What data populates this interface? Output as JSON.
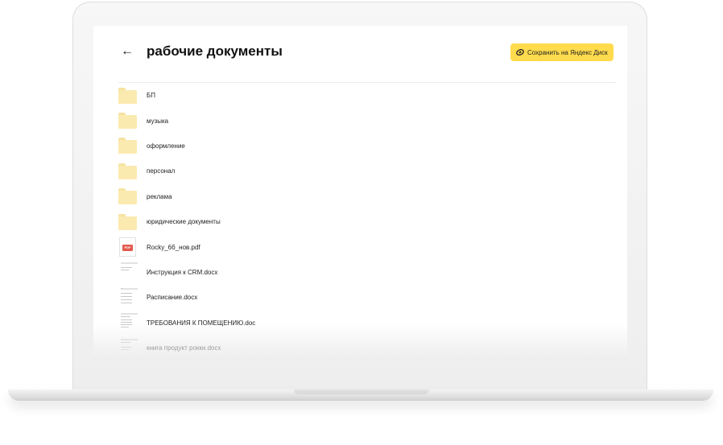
{
  "header": {
    "back_label": "←",
    "title": "рабочие документы",
    "save_button_label": "Сохранить на Яндекс Диск",
    "save_button_color": "#ffdb4d"
  },
  "files": [
    {
      "name": "БП",
      "type": "folder",
      "icon": "folder-icon"
    },
    {
      "name": "музыка",
      "type": "folder",
      "icon": "folder-icon"
    },
    {
      "name": "оформление",
      "type": "folder",
      "icon": "folder-icon"
    },
    {
      "name": "персонал",
      "type": "folder",
      "icon": "folder-icon"
    },
    {
      "name": "реклама",
      "type": "folder",
      "icon": "folder-icon"
    },
    {
      "name": "юридические документы",
      "type": "folder",
      "icon": "folder-icon"
    },
    {
      "name": "Rocky_6б_нов.pdf",
      "type": "pdf",
      "icon": "pdf-file-icon",
      "badge": "PDF"
    },
    {
      "name": "Инструкция к CRM.docx",
      "type": "docx",
      "icon": "document-thumbnail"
    },
    {
      "name": "Расписание.docx",
      "type": "docx",
      "icon": "document-thumbnail"
    },
    {
      "name": "ТРЕБОВАНИЯ К ПОМЕЩЕНИЮ.doc",
      "type": "doc",
      "icon": "document-thumbnail"
    },
    {
      "name": "книга продукт рокки.docx",
      "type": "docx",
      "icon": "document-thumbnail"
    }
  ]
}
